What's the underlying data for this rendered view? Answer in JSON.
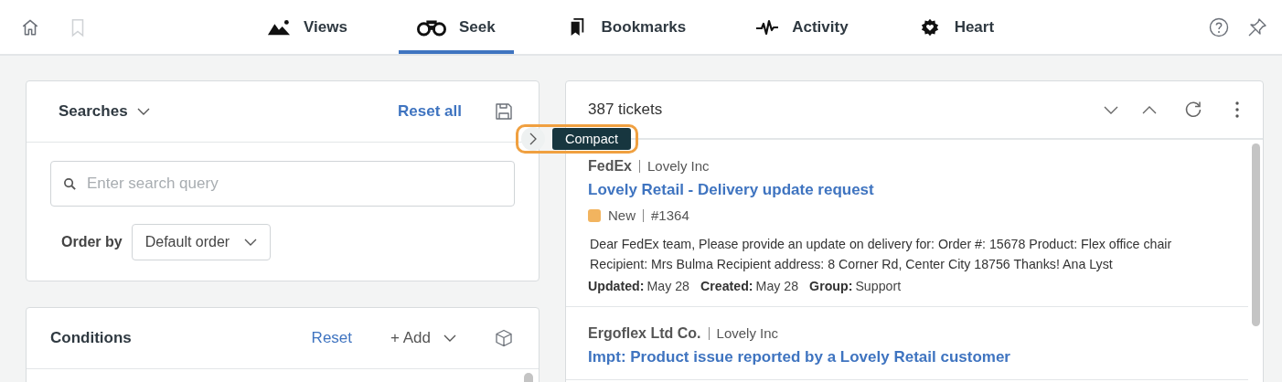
{
  "nav": {
    "tabs": [
      {
        "label": "Views",
        "selected": false
      },
      {
        "label": "Seek",
        "selected": true
      },
      {
        "label": "Bookmarks",
        "selected": false
      },
      {
        "label": "Activity",
        "selected": false
      },
      {
        "label": "Heart",
        "selected": false
      }
    ]
  },
  "searches": {
    "title": "Searches",
    "reset": "Reset all",
    "search": {
      "placeholder": "Enter search query"
    },
    "order_label": "Order by",
    "order_value": "Default order"
  },
  "conditions": {
    "title": "Conditions",
    "reset": "Reset",
    "add": "+ Add"
  },
  "tooltip": "Compact",
  "results": {
    "count": "387 tickets",
    "tickets": [
      {
        "company": "FedEx",
        "org": "Lovely Inc",
        "title": "Lovely Retail - Delivery update request",
        "status": "New",
        "color": "#f2b45f",
        "number": "#1364",
        "body": "Dear FedEx team, Please provide an update on delivery for: Order #: 15678 Product: Flex office chair Recipient: Mrs Bulma Recipient address: 8 Corner Rd, Center City 18756 Thanks! Ana Lyst",
        "meta": [
          {
            "label": "Updated:",
            "value": "May 28"
          },
          {
            "label": "Created:",
            "value": "May 28"
          },
          {
            "label": "Group:",
            "value": "Support"
          }
        ]
      },
      {
        "company": "Ergoflex Ltd Co.",
        "org": "Lovely Inc",
        "title": "Impt: Product issue reported by a Lovely Retail customer"
      }
    ]
  }
}
